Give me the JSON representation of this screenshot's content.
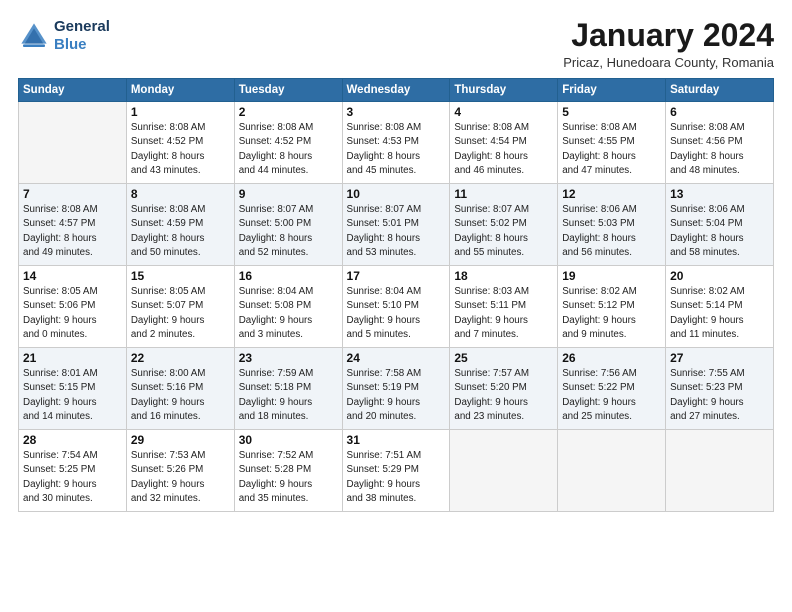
{
  "header": {
    "logo_line1": "General",
    "logo_line2": "Blue",
    "month": "January 2024",
    "location": "Pricaz, Hunedoara County, Romania"
  },
  "weekdays": [
    "Sunday",
    "Monday",
    "Tuesday",
    "Wednesday",
    "Thursday",
    "Friday",
    "Saturday"
  ],
  "weeks": [
    [
      {
        "day": "",
        "sunrise": "",
        "sunset": "",
        "daylight": "",
        "empty": true
      },
      {
        "day": "1",
        "sunrise": "Sunrise: 8:08 AM",
        "sunset": "Sunset: 4:52 PM",
        "daylight": "Daylight: 8 hours and 43 minutes."
      },
      {
        "day": "2",
        "sunrise": "Sunrise: 8:08 AM",
        "sunset": "Sunset: 4:52 PM",
        "daylight": "Daylight: 8 hours and 44 minutes."
      },
      {
        "day": "3",
        "sunrise": "Sunrise: 8:08 AM",
        "sunset": "Sunset: 4:53 PM",
        "daylight": "Daylight: 8 hours and 45 minutes."
      },
      {
        "day": "4",
        "sunrise": "Sunrise: 8:08 AM",
        "sunset": "Sunset: 4:54 PM",
        "daylight": "Daylight: 8 hours and 46 minutes."
      },
      {
        "day": "5",
        "sunrise": "Sunrise: 8:08 AM",
        "sunset": "Sunset: 4:55 PM",
        "daylight": "Daylight: 8 hours and 47 minutes."
      },
      {
        "day": "6",
        "sunrise": "Sunrise: 8:08 AM",
        "sunset": "Sunset: 4:56 PM",
        "daylight": "Daylight: 8 hours and 48 minutes."
      }
    ],
    [
      {
        "day": "7",
        "sunrise": "Sunrise: 8:08 AM",
        "sunset": "Sunset: 4:57 PM",
        "daylight": "Daylight: 8 hours and 49 minutes."
      },
      {
        "day": "8",
        "sunrise": "Sunrise: 8:08 AM",
        "sunset": "Sunset: 4:59 PM",
        "daylight": "Daylight: 8 hours and 50 minutes."
      },
      {
        "day": "9",
        "sunrise": "Sunrise: 8:07 AM",
        "sunset": "Sunset: 5:00 PM",
        "daylight": "Daylight: 8 hours and 52 minutes."
      },
      {
        "day": "10",
        "sunrise": "Sunrise: 8:07 AM",
        "sunset": "Sunset: 5:01 PM",
        "daylight": "Daylight: 8 hours and 53 minutes."
      },
      {
        "day": "11",
        "sunrise": "Sunrise: 8:07 AM",
        "sunset": "Sunset: 5:02 PM",
        "daylight": "Daylight: 8 hours and 55 minutes."
      },
      {
        "day": "12",
        "sunrise": "Sunrise: 8:06 AM",
        "sunset": "Sunset: 5:03 PM",
        "daylight": "Daylight: 8 hours and 56 minutes."
      },
      {
        "day": "13",
        "sunrise": "Sunrise: 8:06 AM",
        "sunset": "Sunset: 5:04 PM",
        "daylight": "Daylight: 8 hours and 58 minutes."
      }
    ],
    [
      {
        "day": "14",
        "sunrise": "Sunrise: 8:05 AM",
        "sunset": "Sunset: 5:06 PM",
        "daylight": "Daylight: 9 hours and 0 minutes."
      },
      {
        "day": "15",
        "sunrise": "Sunrise: 8:05 AM",
        "sunset": "Sunset: 5:07 PM",
        "daylight": "Daylight: 9 hours and 2 minutes."
      },
      {
        "day": "16",
        "sunrise": "Sunrise: 8:04 AM",
        "sunset": "Sunset: 5:08 PM",
        "daylight": "Daylight: 9 hours and 3 minutes."
      },
      {
        "day": "17",
        "sunrise": "Sunrise: 8:04 AM",
        "sunset": "Sunset: 5:10 PM",
        "daylight": "Daylight: 9 hours and 5 minutes."
      },
      {
        "day": "18",
        "sunrise": "Sunrise: 8:03 AM",
        "sunset": "Sunset: 5:11 PM",
        "daylight": "Daylight: 9 hours and 7 minutes."
      },
      {
        "day": "19",
        "sunrise": "Sunrise: 8:02 AM",
        "sunset": "Sunset: 5:12 PM",
        "daylight": "Daylight: 9 hours and 9 minutes."
      },
      {
        "day": "20",
        "sunrise": "Sunrise: 8:02 AM",
        "sunset": "Sunset: 5:14 PM",
        "daylight": "Daylight: 9 hours and 11 minutes."
      }
    ],
    [
      {
        "day": "21",
        "sunrise": "Sunrise: 8:01 AM",
        "sunset": "Sunset: 5:15 PM",
        "daylight": "Daylight: 9 hours and 14 minutes."
      },
      {
        "day": "22",
        "sunrise": "Sunrise: 8:00 AM",
        "sunset": "Sunset: 5:16 PM",
        "daylight": "Daylight: 9 hours and 16 minutes."
      },
      {
        "day": "23",
        "sunrise": "Sunrise: 7:59 AM",
        "sunset": "Sunset: 5:18 PM",
        "daylight": "Daylight: 9 hours and 18 minutes."
      },
      {
        "day": "24",
        "sunrise": "Sunrise: 7:58 AM",
        "sunset": "Sunset: 5:19 PM",
        "daylight": "Daylight: 9 hours and 20 minutes."
      },
      {
        "day": "25",
        "sunrise": "Sunrise: 7:57 AM",
        "sunset": "Sunset: 5:20 PM",
        "daylight": "Daylight: 9 hours and 23 minutes."
      },
      {
        "day": "26",
        "sunrise": "Sunrise: 7:56 AM",
        "sunset": "Sunset: 5:22 PM",
        "daylight": "Daylight: 9 hours and 25 minutes."
      },
      {
        "day": "27",
        "sunrise": "Sunrise: 7:55 AM",
        "sunset": "Sunset: 5:23 PM",
        "daylight": "Daylight: 9 hours and 27 minutes."
      }
    ],
    [
      {
        "day": "28",
        "sunrise": "Sunrise: 7:54 AM",
        "sunset": "Sunset: 5:25 PM",
        "daylight": "Daylight: 9 hours and 30 minutes."
      },
      {
        "day": "29",
        "sunrise": "Sunrise: 7:53 AM",
        "sunset": "Sunset: 5:26 PM",
        "daylight": "Daylight: 9 hours and 32 minutes."
      },
      {
        "day": "30",
        "sunrise": "Sunrise: 7:52 AM",
        "sunset": "Sunset: 5:28 PM",
        "daylight": "Daylight: 9 hours and 35 minutes."
      },
      {
        "day": "31",
        "sunrise": "Sunrise: 7:51 AM",
        "sunset": "Sunset: 5:29 PM",
        "daylight": "Daylight: 9 hours and 38 minutes."
      },
      {
        "day": "",
        "sunrise": "",
        "sunset": "",
        "daylight": "",
        "empty": true
      },
      {
        "day": "",
        "sunrise": "",
        "sunset": "",
        "daylight": "",
        "empty": true
      },
      {
        "day": "",
        "sunrise": "",
        "sunset": "",
        "daylight": "",
        "empty": true
      }
    ]
  ]
}
